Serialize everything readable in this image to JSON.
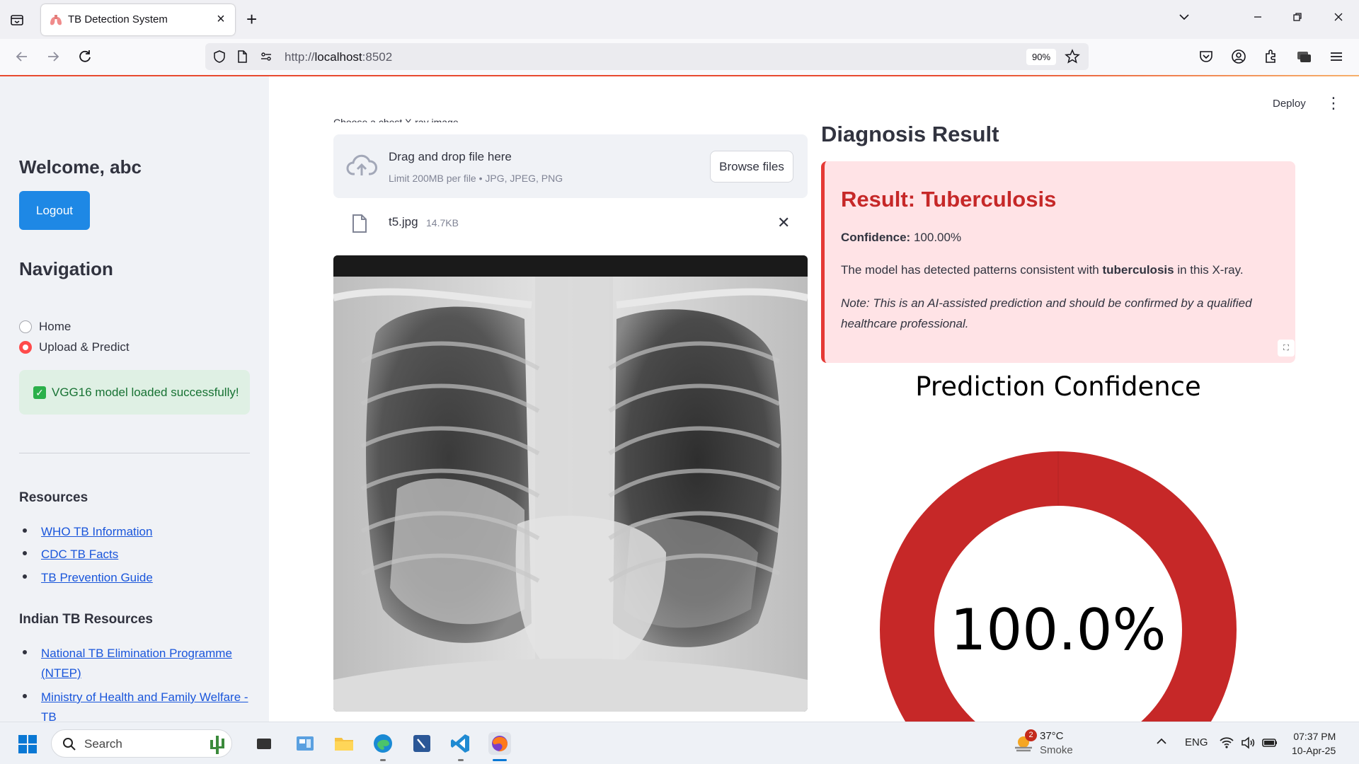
{
  "browser": {
    "tab_title": "TB Detection System",
    "url_prefix": "http://",
    "url_host": "localhost",
    "url_suffix": ":8502",
    "zoom": "90%"
  },
  "app": {
    "deploy_label": "Deploy"
  },
  "sidebar": {
    "welcome": "Welcome, abc",
    "logout_label": "Logout",
    "navigation_heading": "Navigation",
    "nav_options": [
      {
        "label": "Home",
        "selected": false
      },
      {
        "label": "Upload & Predict",
        "selected": true
      }
    ],
    "model_status": "VGG16 model loaded successfully!",
    "resources_heading": "Resources",
    "resources": [
      "WHO TB Information",
      "CDC TB Facts",
      "TB Prevention Guide"
    ],
    "indian_heading": "Indian TB Resources",
    "indian_resources": [
      {
        "line1": "National TB Elimination Programme",
        "line2": "(NTEP)"
      },
      {
        "line1": "Ministry of Health and Family Welfare -",
        "line2": "TB"
      }
    ]
  },
  "uploader": {
    "label": "Choose a chest X-ray image...",
    "drop_title": "Drag and drop file here",
    "limit_text": "Limit 200MB per file • JPG, JPEG, PNG",
    "browse_label": "Browse files",
    "file_name": "t5.jpg",
    "file_size": "14.7KB"
  },
  "diagnosis": {
    "heading": "Diagnosis Result",
    "result_title": "Result: Tuberculosis",
    "confidence_label": "Confidence:",
    "confidence_value": "100.00%",
    "detected_prefix": "The model has detected patterns consistent with",
    "detected_bold": "tuberculosis",
    "detected_suffix": "in this X-ray.",
    "note": "Note: This is an AI-assisted prediction and should be confirmed by a qualified healthcare professional."
  },
  "chart_data": {
    "type": "pie",
    "title": "Prediction Confidence",
    "center_label": "100.0%",
    "slices": [
      {
        "value": 100.0
      }
    ],
    "colors": [
      "#c62828"
    ]
  },
  "taskbar": {
    "search_placeholder": "Search",
    "weather_temp": "37°C",
    "weather_desc": "Smoke",
    "weather_badge": "2",
    "language": "ENG",
    "time": "07:37 PM",
    "date": "10-Apr-25"
  }
}
